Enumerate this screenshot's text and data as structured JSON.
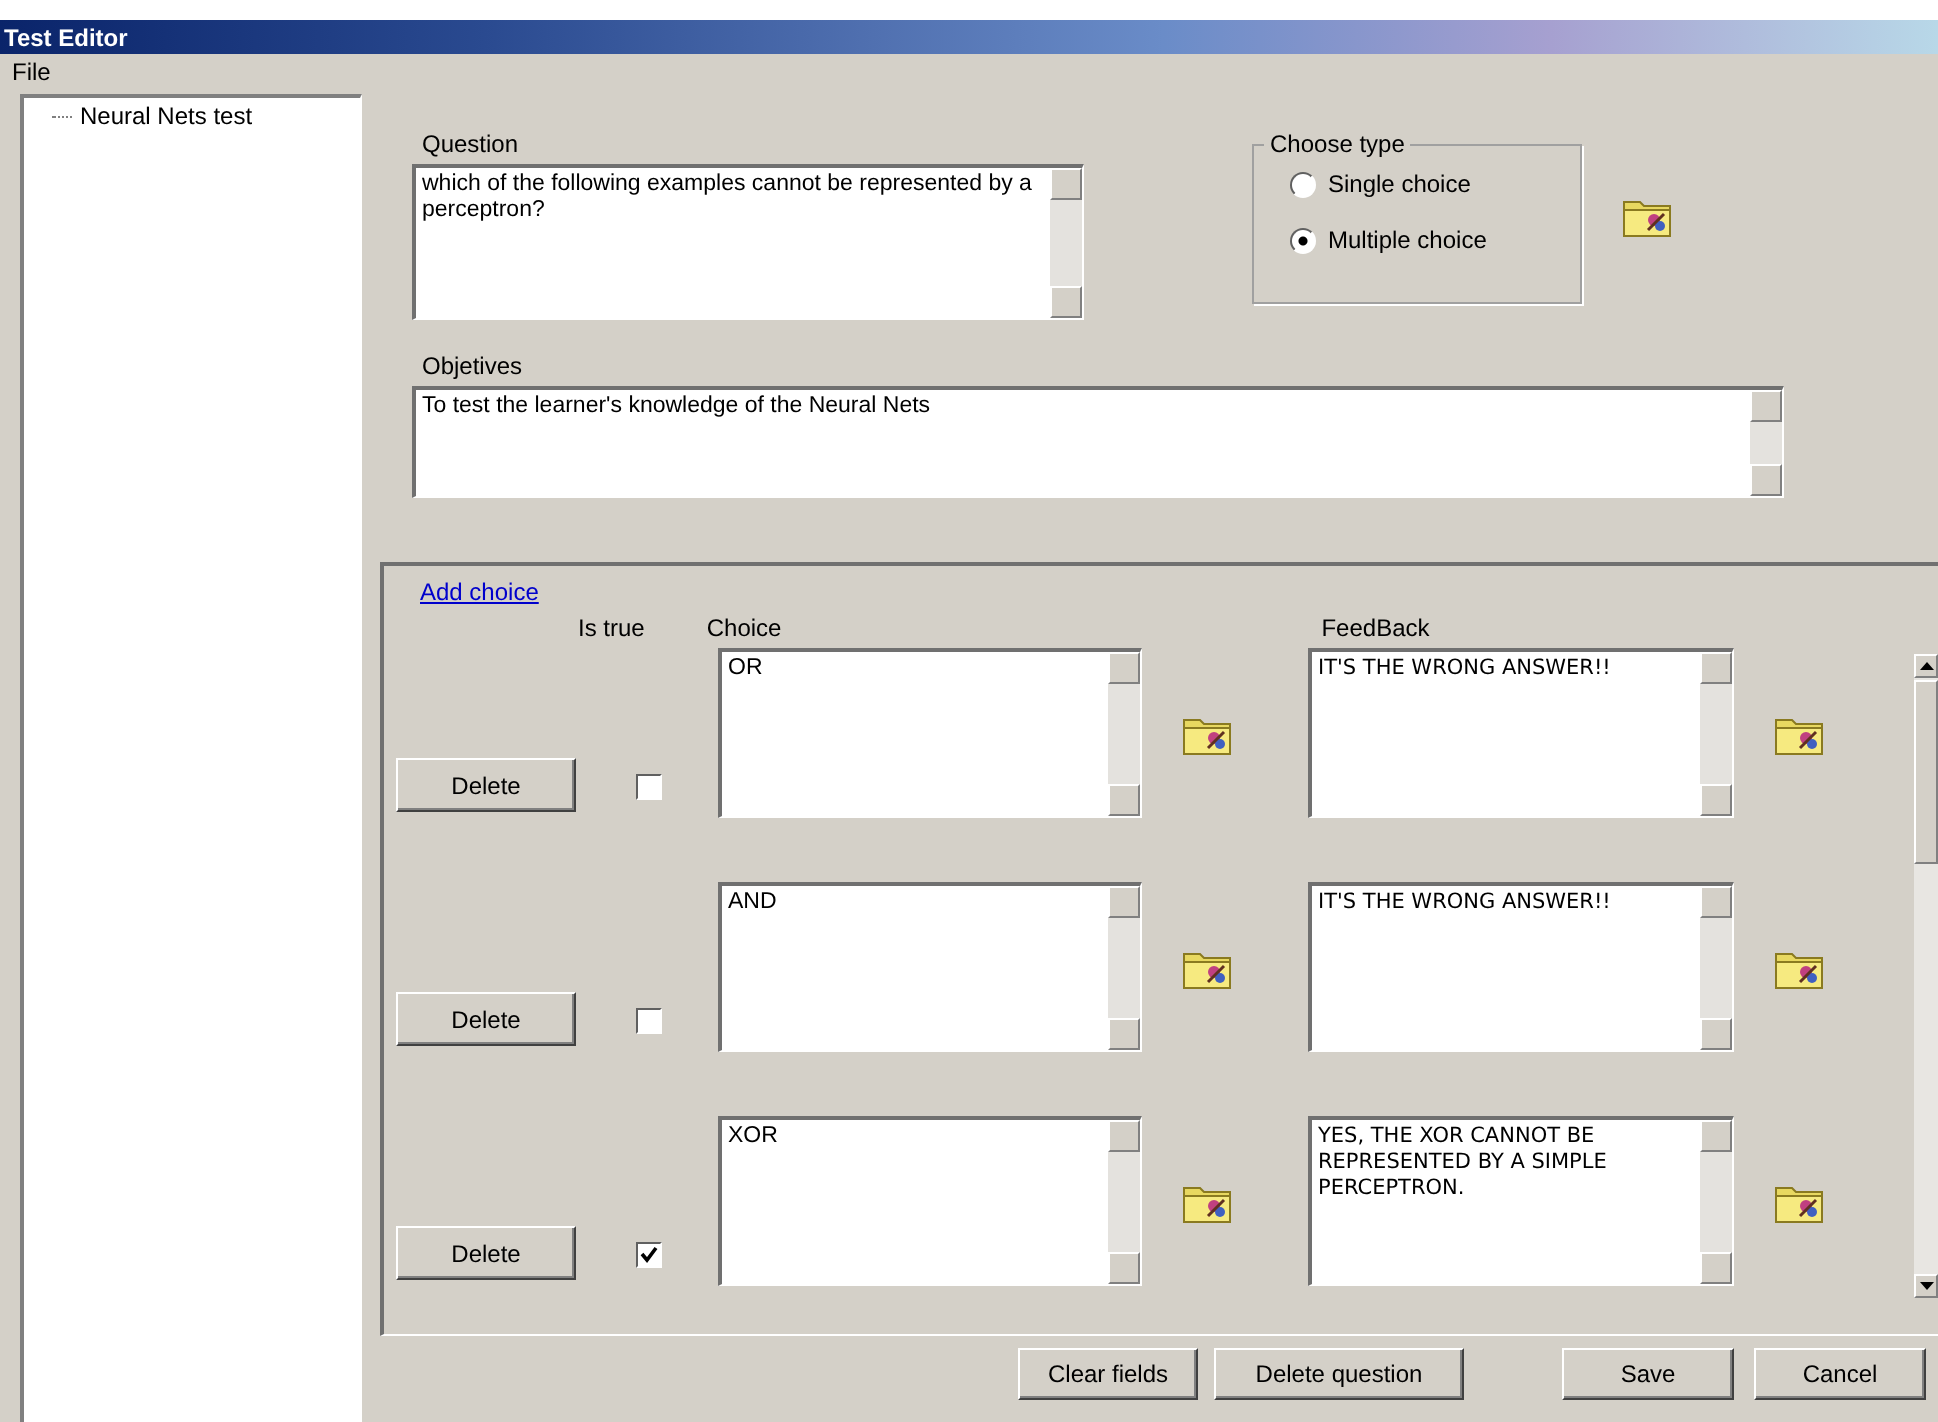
{
  "window": {
    "title": "Test Editor"
  },
  "menu": [
    "File"
  ],
  "tree": {
    "items": [
      {
        "label": "Neural Nets test"
      }
    ]
  },
  "question": {
    "label": "Question",
    "value": "which of the following examples cannot be represented by a perceptron?"
  },
  "choose_type": {
    "label": "Choose type",
    "options": [
      {
        "label": "Single choice",
        "selected": false
      },
      {
        "label": "Multiple choice",
        "selected": true
      }
    ]
  },
  "objectives": {
    "label": "Objetives",
    "value": "To test the learner's knowledge of the Neural Nets"
  },
  "add_choice": "Add choice",
  "columns": {
    "is_true": "Is true",
    "choice": "Choice",
    "feedback": "FeedBack"
  },
  "choices": [
    {
      "delete": "Delete",
      "is_true": false,
      "choice": "OR",
      "feedback": "IT'S THE WRONG ANSWER!!"
    },
    {
      "delete": "Delete",
      "is_true": false,
      "choice": "AND",
      "feedback": "IT'S THE WRONG ANSWER!!"
    },
    {
      "delete": "Delete",
      "is_true": true,
      "choice": "XOR",
      "feedback": "YES, THE XOR CANNOT BE REPRESENTED BY A SIMPLE PERCEPTRON."
    }
  ],
  "buttons": [
    "Clear fields",
    "Delete question",
    "Save",
    "Cancel"
  ]
}
